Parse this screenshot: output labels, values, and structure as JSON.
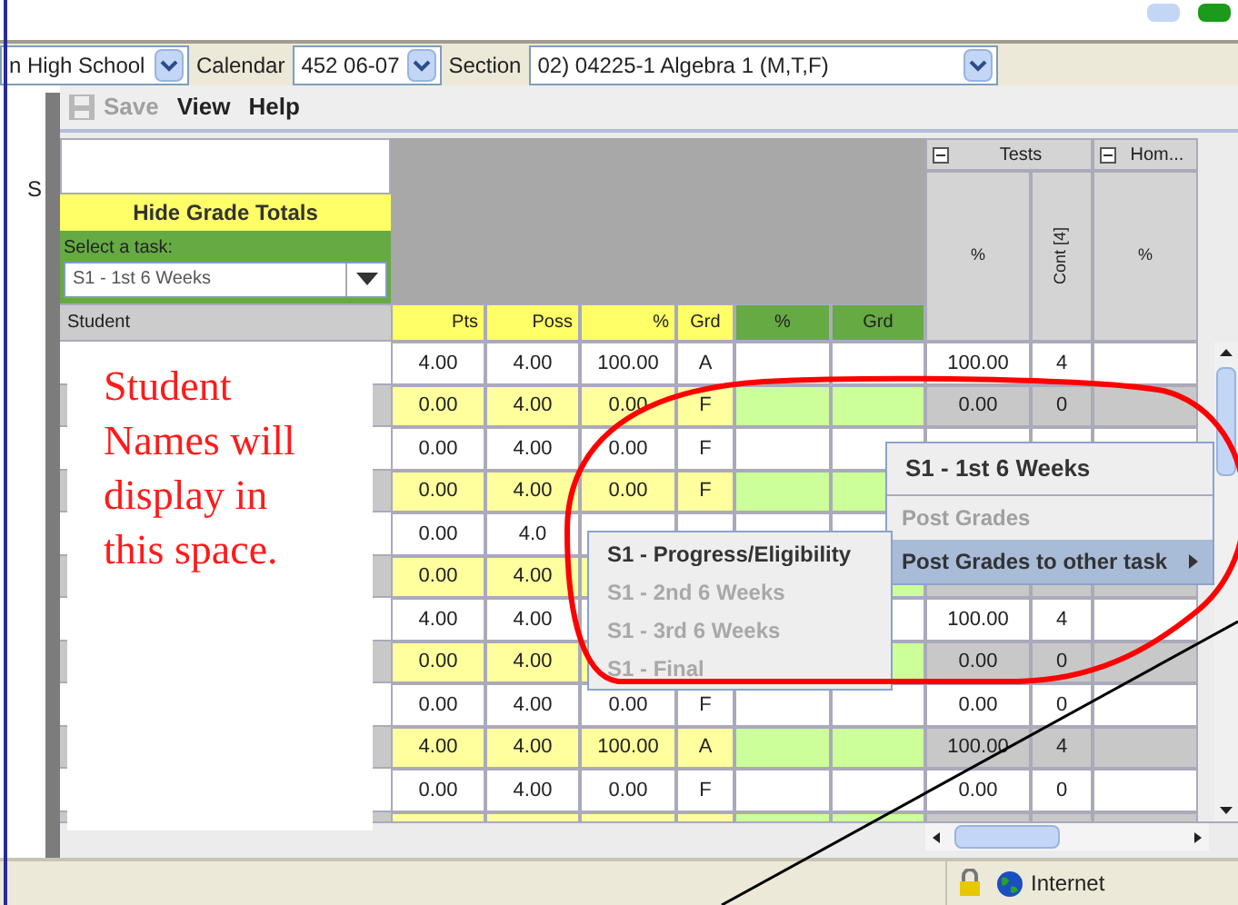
{
  "toolbar": {
    "school": "n High School",
    "calendar_label": "Calendar",
    "calendar": "452 06-07",
    "section_label": "Section",
    "section": "02) 04225-1 Algebra 1 (M,T,F)"
  },
  "menu": [
    {
      "label": "Save",
      "disabled": true
    },
    {
      "label": "View",
      "disabled": false
    },
    {
      "label": "Help",
      "disabled": false
    }
  ],
  "side_letter": "S",
  "hide_totals": "Hide Grade Totals",
  "task": {
    "label": "Select a task:",
    "value": "S1 - 1st 6 Weeks"
  },
  "student_header": "Student",
  "note": "Student Names will display in this space.",
  "columns": [
    {
      "label": "Pts",
      "kind": "total"
    },
    {
      "label": "Poss",
      "kind": "total"
    },
    {
      "label": "%",
      "kind": "total"
    },
    {
      "label": "Grd",
      "kind": "total"
    },
    {
      "label": "%",
      "kind": "task"
    },
    {
      "label": "Grd",
      "kind": "task"
    }
  ],
  "groups": [
    {
      "label": "Tests",
      "expanded": true
    },
    {
      "label": "Hom...",
      "expanded": true
    }
  ],
  "sub_columns": [
    {
      "label": "%",
      "kind": "plain"
    },
    {
      "label": "Cont [4]",
      "kind": "vertical"
    },
    {
      "label": "%",
      "kind": "plain"
    }
  ],
  "rows": [
    {
      "shaded": false,
      "cells": [
        "4.00",
        "4.00",
        "100.00",
        "A",
        "100.00",
        "4"
      ]
    },
    {
      "shaded": true,
      "cells": [
        "0.00",
        "4.00",
        "0.00",
        "F",
        "0.00",
        "0"
      ]
    },
    {
      "shaded": false,
      "cells": [
        "0.00",
        "4.00",
        "0.00",
        "F",
        null,
        null
      ]
    },
    {
      "shaded": true,
      "cells": [
        "0.00",
        "4.00",
        "0.00",
        "F",
        null,
        null
      ]
    },
    {
      "shaded": false,
      "cells": [
        "0.00",
        "4.0",
        null,
        null,
        null,
        null
      ]
    },
    {
      "shaded": true,
      "cells": [
        "0.00",
        "4.00",
        null,
        null,
        null,
        null
      ]
    },
    {
      "shaded": false,
      "cells": [
        "4.00",
        "4.00",
        null,
        null,
        "100.00",
        "4"
      ]
    },
    {
      "shaded": true,
      "cells": [
        "0.00",
        "4.00",
        null,
        null,
        "0.00",
        "0"
      ]
    },
    {
      "shaded": false,
      "cells": [
        "0.00",
        "4.00",
        "0.00",
        "F",
        "0.00",
        "0"
      ]
    },
    {
      "shaded": true,
      "cells": [
        "4.00",
        "4.00",
        "100.00",
        "A",
        "100.00",
        "4"
      ]
    },
    {
      "shaded": false,
      "cells": [
        "0.00",
        "4.00",
        "0.00",
        "F",
        "0.00",
        "0"
      ]
    },
    {
      "shaded": true,
      "cells": [
        null,
        null,
        null,
        null,
        null,
        null
      ]
    }
  ],
  "context_menu": {
    "title": "S1 - 1st 6 Weeks",
    "items": [
      {
        "label": "Post Grades",
        "disabled": true,
        "selected": false,
        "submenu": false
      },
      {
        "label": "Post Grades to other task",
        "disabled": false,
        "selected": true,
        "submenu": true
      }
    ]
  },
  "submenu": [
    {
      "label": "S1 - Progress/Eligibility",
      "disabled": false
    },
    {
      "label": "S1 - 2nd 6 Weeks",
      "disabled": true
    },
    {
      "label": "S1 - 3rd 6 Weeks",
      "disabled": true
    },
    {
      "label": "S1 - Final",
      "disabled": true
    }
  ],
  "status": {
    "zone": "Internet"
  }
}
